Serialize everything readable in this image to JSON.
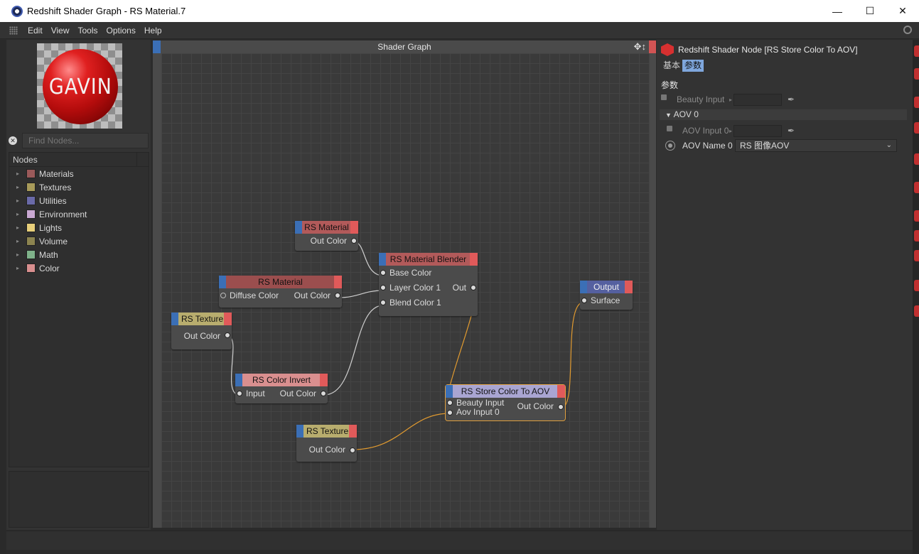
{
  "window": {
    "title": "Redshift Shader Graph - RS Material.7",
    "controls": [
      "minimize",
      "maximize",
      "close"
    ]
  },
  "menu": [
    "Edit",
    "View",
    "Tools",
    "Options",
    "Help"
  ],
  "preview": {
    "text": "GAVIN"
  },
  "find": {
    "placeholder": "Find Nodes..."
  },
  "nodes_panel": {
    "header": "Nodes",
    "categories": [
      {
        "label": "Materials",
        "color": "#9b5a5a"
      },
      {
        "label": "Textures",
        "color": "#a89b5a"
      },
      {
        "label": "Utilities",
        "color": "#6a6aa8"
      },
      {
        "label": "Environment",
        "color": "#c9a8d2"
      },
      {
        "label": "Lights",
        "color": "#e8cf7a"
      },
      {
        "label": "Volume",
        "color": "#8c8450"
      },
      {
        "label": "Math",
        "color": "#7fb28a"
      },
      {
        "label": "Color",
        "color": "#d98f8f"
      }
    ]
  },
  "graph": {
    "title": "Shader Graph",
    "nodes": [
      {
        "title": "RS Material",
        "header_color": "#b25a5a",
        "rows": [
          {
            "right": "Out Color"
          }
        ]
      },
      {
        "title": "RS Material Blender",
        "header_color": "#b25a5a",
        "rows": [
          {
            "left": "Base Color"
          },
          {
            "left": "Layer Color 1",
            "right": "Out"
          },
          {
            "left": "Blend Color 1"
          }
        ]
      },
      {
        "title": "RS Material",
        "header_color": "#9b4e4e",
        "rows": [
          {
            "left": "Diffuse Color",
            "right": "Out Color"
          }
        ]
      },
      {
        "title": "RS Texture",
        "header_color": "#b8ad6e",
        "rows": [
          {
            "right": "Out Color"
          }
        ]
      },
      {
        "title": "RS Color Invert",
        "header_color": "#d98f8f",
        "rows": [
          {
            "left": "Input",
            "right": "Out Color"
          }
        ]
      },
      {
        "title": "Output",
        "header_color": "#5560a0",
        "rows": [
          {
            "left": "Surface"
          }
        ]
      },
      {
        "title": "RS Store Color To AOV",
        "header_color": "#a9a5d2",
        "rows": [
          {
            "left": "Beauty Input"
          },
          {
            "left": "Aov Input 0",
            "right": "Out Color"
          }
        ]
      },
      {
        "title": "RS Texture",
        "header_color": "#b8ad6e",
        "rows": [
          {
            "right": "Out Color"
          }
        ]
      }
    ]
  },
  "attributes": {
    "title": "Redshift Shader Node [RS Store Color To AOV]",
    "tabs": [
      "基本",
      "参数"
    ],
    "active_tab": "参数",
    "section": "参数",
    "beauty_input_label": "Beauty Input",
    "aov_group_label": "AOV 0",
    "aov_input_label": "AOV Input 0",
    "aov_name_label": "AOV Name 0",
    "aov_name_value": "RS 图像AOV"
  }
}
